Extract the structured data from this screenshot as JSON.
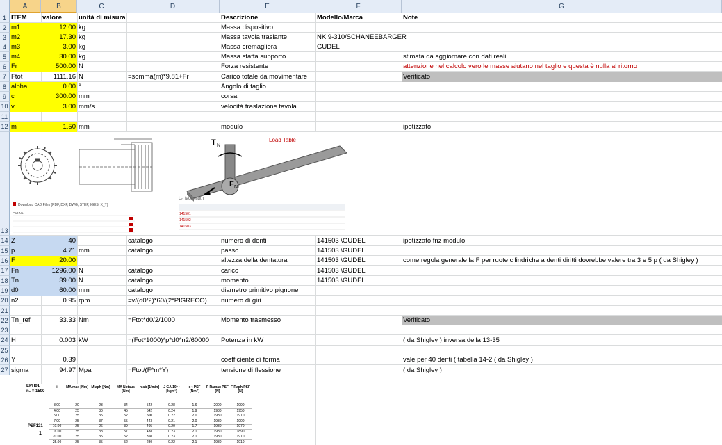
{
  "columns": [
    "A",
    "B",
    "C",
    "D",
    "E",
    "F",
    "G"
  ],
  "headers": {
    "item": "ITEM",
    "valore": "valore",
    "unita": "unità di misura",
    "descrizione": "Descrizione",
    "modello": "Modello/Marca",
    "note": "Note"
  },
  "rows": {
    "r2": {
      "a": "m1",
      "b": "12.00",
      "c": "kg",
      "e": "Massa dispositivo"
    },
    "r3": {
      "a": "m2",
      "b": "17.30",
      "c": "kg",
      "e": "Massa tavola traslante",
      "f": "NK 9-310/SCHANEEBARGER"
    },
    "r4": {
      "a": "m3",
      "b": "3.00",
      "c": "kg",
      "e": "Massa cremagliera",
      "f": "GUDEL"
    },
    "r5": {
      "a": "m4",
      "b": "30.00",
      "c": "kg",
      "e": "Massa staffa supporto",
      "g": "stimata da aggiornare con dati reali"
    },
    "r6": {
      "a": "Fr",
      "b": "500.00",
      "c": "N",
      "e": "Forza resistente",
      "g": "attenzione nel calcolo vero le masse aiutano nel taglio e questa è nulla al ritorno"
    },
    "r7": {
      "a": "Ftot",
      "b": "1111.16",
      "c": "N",
      "d": "=somma(m)*9.81+Fr",
      "e": "Carico totale da movimentare",
      "g": "Verificato"
    },
    "r8": {
      "a": "alpha",
      "b": "0.00",
      "c": "°",
      "e": "Angolo di taglio"
    },
    "r9": {
      "a": "c",
      "b": "300.00",
      "c": "mm",
      "e": "corsa"
    },
    "r10": {
      "a": "v",
      "b": "3.00",
      "c": "mm/s",
      "e": "velocità traslazione tavola"
    },
    "r12": {
      "a": "m",
      "b": "1.50",
      "c": "mm",
      "e": "modulo",
      "g": "ipotizzato"
    },
    "r14": {
      "a": "Z",
      "b": "40",
      "d": "catalogo",
      "e": "numero di denti",
      "f": "141503 \\GUDEL",
      "g": "ipotizzato fnz modulo"
    },
    "r15": {
      "a": "p",
      "b": "4.71",
      "c": "mm",
      "d": "catalogo",
      "e": "passo",
      "f": "141503 \\GUDEL"
    },
    "r16": {
      "a": "F",
      "b": "20.00",
      "e": "altezza della dentatura",
      "f": "141503 \\GUDEL",
      "g": "come regola generale la F per ruote cilindriche a denti diritti dovrebbe valere tra 3 e 5 p ( da Shigley )"
    },
    "r17": {
      "a": "Fn",
      "b": "1296.00",
      "c": "N",
      "d": "catalogo",
      "e": "carico",
      "f": "141503 \\GUDEL"
    },
    "r18": {
      "a": "Tn",
      "b": "39.00",
      "c": "N",
      "d": "catalogo",
      "e": "momento",
      "f": "141503 \\GUDEL"
    },
    "r19": {
      "a": "d0",
      "b": "60.00",
      "c": "mm",
      "d": "catalogo",
      "e": "diametro primitivo pignone"
    },
    "r20": {
      "a": "n2",
      "b": "0.95",
      "c": "rpm",
      "d": "=v/(d0/2)*60/(2*PIGRECO)",
      "e": "numero di giri"
    },
    "r22": {
      "a": "Tn_ref",
      "b": "33.33",
      "c": "Nm",
      "d": "=Ftot*d0/2/1000",
      "e": "Momento trasmesso",
      "g": "Verificato"
    },
    "r24": {
      "a": "H",
      "b": "0.003",
      "c": "kW",
      "d": "=(Fot*1000)*p*d0*n2/60000",
      "e": "Potenza in kW",
      "g": " ( da Shigley ) inversa della 13-35"
    },
    "r26": {
      "a": "Y",
      "b": "0.39",
      "e": "coefficiente di forma",
      "g": "vale per 40 denti ( tabella 14-2  ( da Shigley )"
    },
    "r27": {
      "a": "sigma",
      "b": "94.97",
      "c": "Mpa",
      "d": "=Ftot/(F*m*Y)",
      "e": "tensione di flessione",
      "g": " ( da Shigley )"
    }
  },
  "catalog_image": {
    "load_table": "Load Table",
    "tn_label": "T",
    "tn_sub": "N",
    "fn_label": "F",
    "fn_sub": "N",
    "face_width": "L₂: face width",
    "download": "Download CAD Files (PDF, DXF, DWG, STEP, IGES, X_T)",
    "part_no": "Part No."
  },
  "eph_table": {
    "title": "EPH01",
    "subtitle": "n₁ = 1500",
    "model": "PSF121",
    "ratio": "1",
    "headers": [
      "i",
      "MA max [Nm]",
      "M aph [Nm]",
      "MA Notaus [Nm]",
      "n ab [1/min]",
      "J GA 10⁻⁴ [kgm²]",
      "c t PSF [Nm/']",
      "F Ramax PSF [N]",
      "F Raph PSF [N]"
    ],
    "rows": [
      [
        "3.00",
        "20",
        "23",
        "34",
        "542",
        "0.28",
        "1.6",
        "2000",
        "1990"
      ],
      [
        "4.00",
        "25",
        "30",
        "45",
        "542",
        "0.24",
        "1.9",
        "1980",
        "1950"
      ],
      [
        "5.00",
        "25",
        "35",
        "52",
        "500",
        "0.22",
        "2.0",
        "1980",
        "1910"
      ],
      [
        "7.00",
        "25",
        "37",
        "55",
        "443",
        "0.21",
        "2.0",
        "1980",
        "1900"
      ],
      [
        "10.00",
        "25",
        "26",
        "39",
        "405",
        "0.20",
        "1.7",
        "1980",
        "1970"
      ],
      [
        "16.00",
        "25",
        "38",
        "57",
        "438",
        "0.23",
        "2.1",
        "1980",
        "1890"
      ],
      [
        "20.00",
        "25",
        "35",
        "52",
        "350",
        "0.23",
        "2.1",
        "1980",
        "1910"
      ],
      [
        "25.00",
        "25",
        "35",
        "52",
        "280",
        "0.22",
        "2.1",
        "1980",
        "1910"
      ]
    ]
  },
  "colors": {
    "yellow": "#ffff00",
    "blue": "#c6d9f1",
    "gray": "#bfbfbf",
    "red": "#c00000",
    "header_bg": "#e4ecf7"
  }
}
